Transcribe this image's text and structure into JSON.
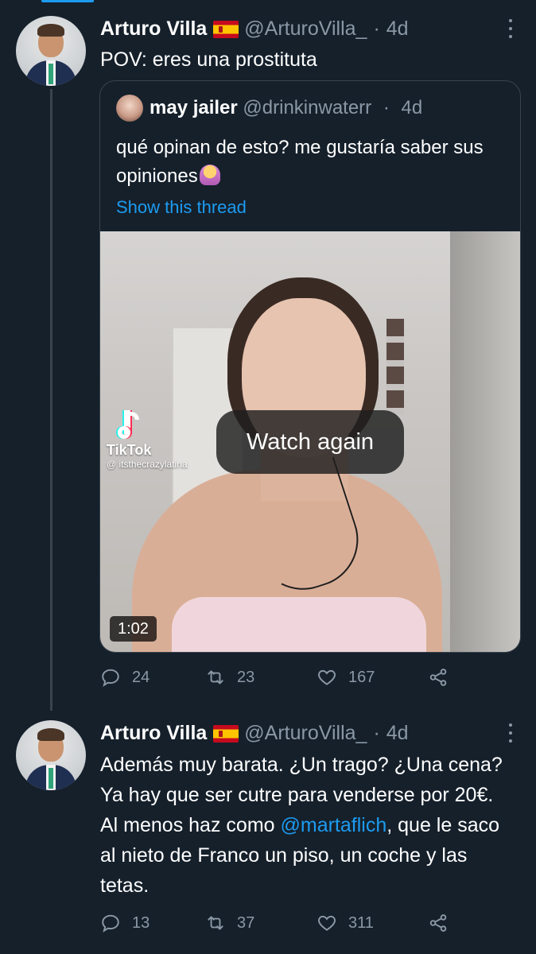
{
  "tweets": [
    {
      "author_name": "Arturo Villa",
      "author_handle": "@ArturoVilla_",
      "separator": "·",
      "time": "4d",
      "text": "POV: eres una prostituta",
      "quote": {
        "author_name": "may jailer",
        "author_handle": "@drinkinwaterr",
        "separator": "·",
        "time": "4d",
        "text": "qué opinan de esto? me gustaría saber sus opiniones",
        "show_thread": "Show this thread",
        "media": {
          "watermark_app": "TikTok",
          "watermark_user": "@ itsthecrazylatina",
          "watch_again": "Watch again",
          "duration": "1:02"
        }
      },
      "stats": {
        "replies": "24",
        "retweets": "23",
        "likes": "167"
      }
    },
    {
      "author_name": "Arturo Villa",
      "author_handle": "@ArturoVilla_",
      "separator": "·",
      "time": "4d",
      "text_before": "Además muy barata. ¿Un trago? ¿Una cena? Ya hay que ser cutre para venderse por 20€. Al menos haz como ",
      "mention": "@martaflich",
      "text_after": ", que le saco al nieto de Franco un piso, un coche y las tetas.",
      "stats": {
        "replies": "13",
        "retweets": "37",
        "likes": "311"
      }
    }
  ],
  "colors": {
    "background": "#15202b",
    "accent": "#1d9bf0",
    "secondary_text": "#8b98a5",
    "border": "#38444d"
  },
  "icons": [
    "reply-icon",
    "retweet-icon",
    "like-icon",
    "share-icon",
    "more-icon",
    "spain-flag-icon",
    "tiktok-icon"
  ]
}
